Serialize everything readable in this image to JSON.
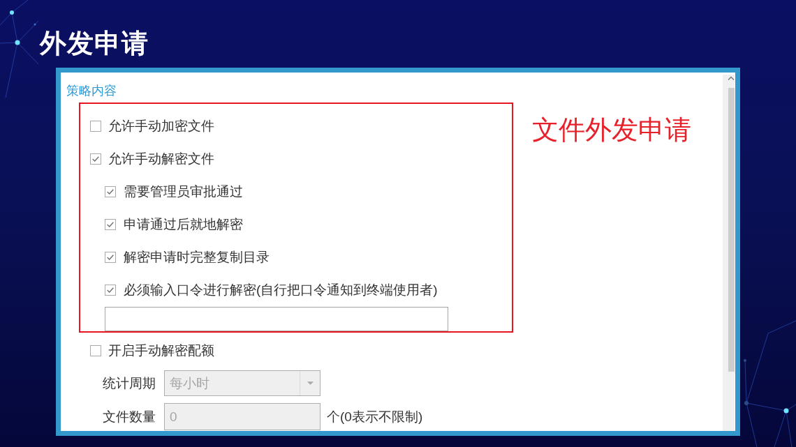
{
  "slide_title": "外发申请",
  "panel": {
    "section_title": "策略内容",
    "highlighted": {
      "options": [
        {
          "label": "允许手动加密文件",
          "checked": false
        },
        {
          "label": "允许手动解密文件",
          "checked": true,
          "children": [
            {
              "kind": "checkbox",
              "label": "需要管理员审批通过",
              "checked": true
            },
            {
              "kind": "checkbox",
              "label": "申请通过后就地解密",
              "checked": true
            },
            {
              "kind": "checkbox",
              "label": "解密申请时完整复制目录",
              "checked": true
            },
            {
              "kind": "checkbox",
              "label": "必须输入口令进行解密(自行把口令通知到终端使用者)",
              "checked": true
            },
            {
              "kind": "text_field"
            }
          ]
        }
      ],
      "annotation": "文件外发申请"
    },
    "quota": {
      "label": "开启手动解密配额",
      "checked": false,
      "fields": [
        {
          "kind": "select",
          "label": "统计周期",
          "value": "每小时",
          "disabled": true
        },
        {
          "kind": "input",
          "label": "文件数量",
          "value": "0",
          "disabled": true,
          "note": "个(0表示不限制)"
        }
      ]
    }
  }
}
